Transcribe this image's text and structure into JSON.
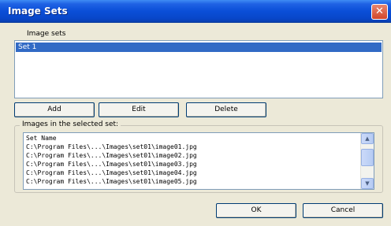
{
  "window": {
    "title": "Image Sets",
    "close_glyph": "✕"
  },
  "list": {
    "label": "Image sets",
    "items": [
      "Set 1"
    ]
  },
  "buttons": {
    "add": "Add",
    "edit": "Edit",
    "delete": "Delete",
    "ok": "OK",
    "cancel": "Cancel"
  },
  "preview": {
    "label": "Images in the selected set:",
    "lines": [
      "Set Name",
      "C:\\Program Files\\...\\Images\\set01\\image01.jpg",
      "C:\\Program Files\\...\\Images\\set01\\image02.jpg",
      "C:\\Program Files\\...\\Images\\set01\\image03.jpg",
      "C:\\Program Files\\...\\Images\\set01\\image04.jpg",
      "C:\\Program Files\\...\\Images\\set01\\image05.jpg"
    ],
    "scroll_up": "▲",
    "scroll_down": "▼"
  }
}
